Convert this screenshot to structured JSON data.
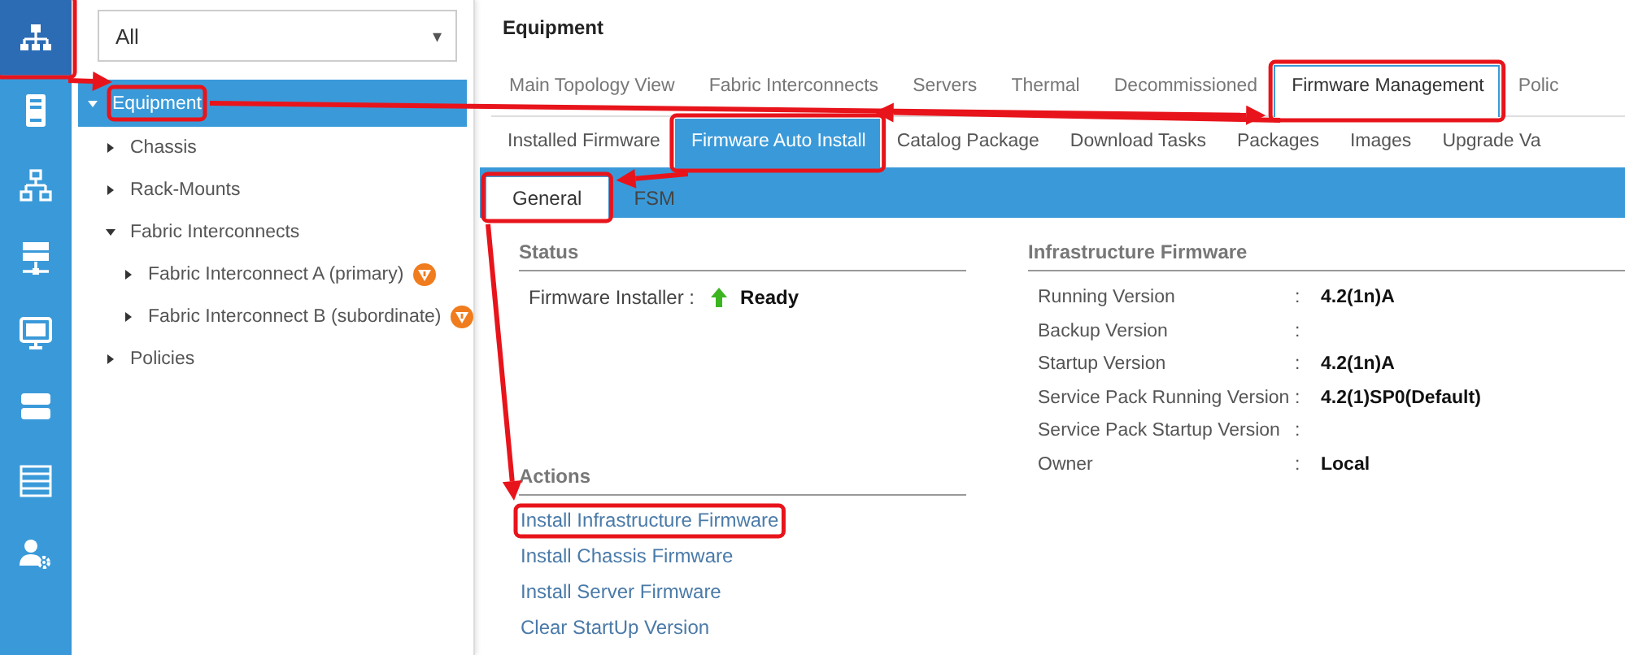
{
  "rail": {
    "items": [
      {
        "selected": true,
        "annotated": true
      },
      {
        "selected": false,
        "annotated": false
      },
      {
        "selected": false,
        "annotated": false
      },
      {
        "selected": false,
        "annotated": false
      },
      {
        "selected": false,
        "annotated": false
      },
      {
        "selected": false,
        "annotated": false
      },
      {
        "selected": false,
        "annotated": false
      },
      {
        "selected": false,
        "annotated": false
      }
    ]
  },
  "filter": {
    "value": "All",
    "caret": "▾"
  },
  "tree": [
    {
      "label": "Equipment",
      "expanded": true,
      "selected": true,
      "annotated": true,
      "children": [
        {
          "label": "Chassis",
          "expanded": false,
          "selected": false,
          "annotated": false
        },
        {
          "label": "Rack-Mounts",
          "expanded": false,
          "selected": false,
          "annotated": false
        },
        {
          "label": "Fabric Interconnects",
          "expanded": true,
          "selected": false,
          "annotated": false,
          "children": [
            {
              "label": "Fabric Interconnect A (primary)",
              "expanded": false,
              "selected": false,
              "annotated": false,
              "warning": true
            },
            {
              "label": "Fabric Interconnect B (subordinate)",
              "expanded": false,
              "selected": false,
              "annotated": false,
              "warning": true
            }
          ]
        },
        {
          "label": "Policies",
          "expanded": false,
          "selected": false,
          "annotated": false
        }
      ]
    }
  ],
  "page_title": "Equipment",
  "tabs": [
    {
      "label": "Main Topology View",
      "selected": false,
      "annotated": false
    },
    {
      "label": "Fabric Interconnects",
      "selected": false,
      "annotated": false
    },
    {
      "label": "Servers",
      "selected": false,
      "annotated": false
    },
    {
      "label": "Thermal",
      "selected": false,
      "annotated": false
    },
    {
      "label": "Decommissioned",
      "selected": false,
      "annotated": false
    },
    {
      "label": "Firmware Management",
      "selected": true,
      "annotated": true
    },
    {
      "label": "Polic",
      "selected": false,
      "annotated": false
    }
  ],
  "subtabs": [
    {
      "label": "Installed Firmware",
      "selected": false,
      "annotated": false
    },
    {
      "label": "Firmware Auto Install",
      "selected": true,
      "annotated": true
    },
    {
      "label": "Catalog Package",
      "selected": false,
      "annotated": false
    },
    {
      "label": "Download Tasks",
      "selected": false,
      "annotated": false
    },
    {
      "label": "Packages",
      "selected": false,
      "annotated": false
    },
    {
      "label": "Images",
      "selected": false,
      "annotated": false
    },
    {
      "label": "Upgrade Va",
      "selected": false,
      "annotated": false
    }
  ],
  "inner_tabs": [
    {
      "label": "General",
      "selected": true,
      "annotated": true
    },
    {
      "label": "FSM",
      "selected": false,
      "annotated": false
    }
  ],
  "status": {
    "heading": "Status",
    "label": "Firmware Installer :",
    "value": "Ready"
  },
  "actions": {
    "heading": "Actions",
    "links": [
      {
        "label": "Install Infrastructure Firmware",
        "annotated": true
      },
      {
        "label": "Install Chassis Firmware",
        "annotated": false
      },
      {
        "label": "Install Server Firmware",
        "annotated": false
      },
      {
        "label": "Clear StartUp Version",
        "annotated": false
      }
    ]
  },
  "infrastructure": {
    "heading": "Infrastructure Firmware",
    "rows": [
      {
        "label": "Running Version",
        "separator": ":",
        "value": "4.2(1n)A"
      },
      {
        "label": "Backup Version",
        "separator": ":"
      },
      {
        "label": "Startup Version",
        "separator": ":",
        "value": "4.2(1n)A"
      },
      {
        "label": "Service Pack Running Version",
        "separator": ":",
        "value": "4.2(1)SP0(Default)"
      },
      {
        "label": "Service Pack Startup Version",
        "separator": ":"
      },
      {
        "label": "Owner",
        "separator": ":",
        "value": "Local"
      }
    ]
  }
}
